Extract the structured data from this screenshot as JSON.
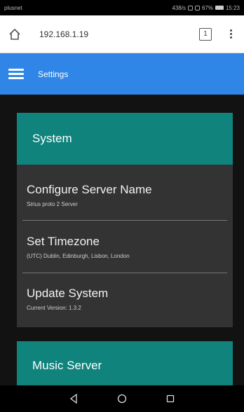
{
  "status_bar": {
    "carrier": "plusnet",
    "indicators": "438/s",
    "battery": "67%",
    "time": "15:23"
  },
  "browser": {
    "url": "192.168.1.19",
    "tab_count": "1"
  },
  "header": {
    "title": "Settings"
  },
  "sections": {
    "system": {
      "title": "System",
      "items": [
        {
          "title": "Configure Server Name",
          "subtitle": "Sirius proto 2 Server"
        },
        {
          "title": "Set Timezone",
          "subtitle": "(UTC) Dublin, Edinburgh, Lisbon, London"
        },
        {
          "title": "Update System",
          "subtitle": "Current Version: 1.3.2"
        }
      ]
    },
    "music": {
      "title": "Music Server"
    }
  },
  "colors": {
    "app_bar": "#2f86e6",
    "card_header": "#10837c",
    "card_body": "#333333"
  },
  "icons": {
    "home": "home-icon",
    "tabs": "tabs-icon",
    "menu": "more-vert-icon",
    "hamburger": "hamburger-icon",
    "back": "back-triangle-icon",
    "home_nav": "home-circle-icon",
    "recents": "recents-square-icon"
  }
}
